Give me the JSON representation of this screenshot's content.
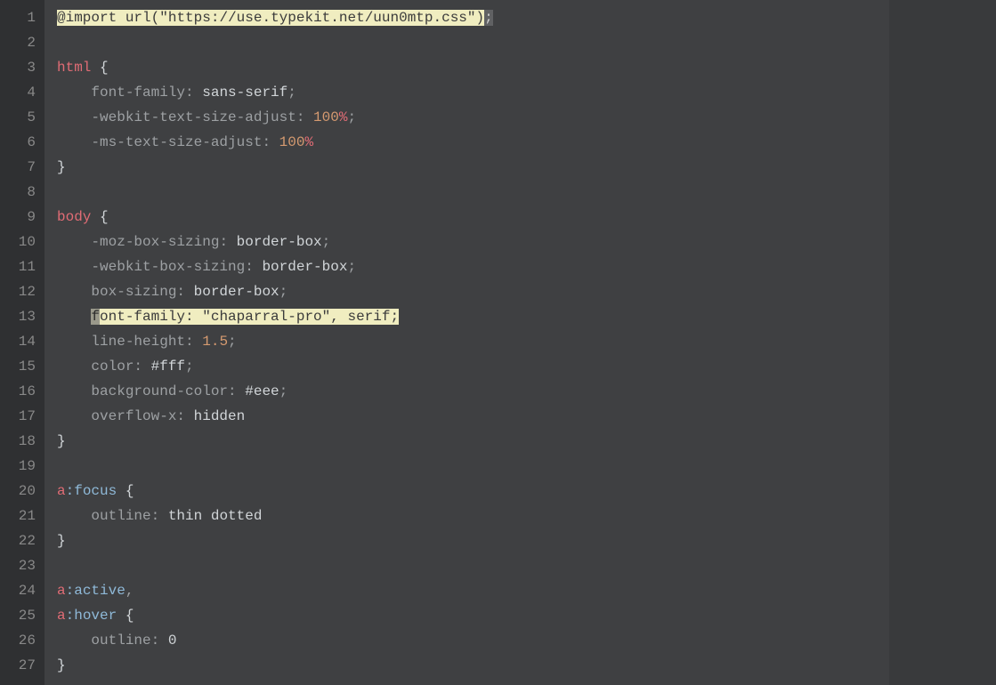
{
  "editor": {
    "lines": [
      {
        "num": "1",
        "tokens": [
          {
            "cls": "hl-yellow",
            "text": "@import"
          },
          {
            "cls": "hl-yellow",
            "text": " "
          },
          {
            "cls": "hl-yellow",
            "text": "url"
          },
          {
            "cls": "hl-yellow",
            "text": "("
          },
          {
            "cls": "hl-yellow",
            "text": "\"https://use.typekit.net/uun0mtp.css\""
          },
          {
            "cls": "hl-yellow",
            "text": ")"
          },
          {
            "cls": "hl-grey",
            "text": ";"
          }
        ]
      },
      {
        "num": "2",
        "tokens": []
      },
      {
        "num": "3",
        "tokens": [
          {
            "cls": "tok-selector",
            "text": "html"
          },
          {
            "cls": "",
            "text": " "
          },
          {
            "cls": "tok-brace",
            "text": "{"
          }
        ]
      },
      {
        "num": "4",
        "tokens": [
          {
            "cls": "",
            "text": "    "
          },
          {
            "cls": "tok-property",
            "text": "font-family"
          },
          {
            "cls": "tok-colon",
            "text": ": "
          },
          {
            "cls": "tok-value",
            "text": "sans-serif"
          },
          {
            "cls": "tok-punct",
            "text": ";"
          }
        ]
      },
      {
        "num": "5",
        "tokens": [
          {
            "cls": "",
            "text": "    "
          },
          {
            "cls": "tok-property",
            "text": "-webkit-text-size-adjust"
          },
          {
            "cls": "tok-colon",
            "text": ": "
          },
          {
            "cls": "tok-number",
            "text": "100"
          },
          {
            "cls": "tok-keyword",
            "text": "%"
          },
          {
            "cls": "tok-punct",
            "text": ";"
          }
        ]
      },
      {
        "num": "6",
        "tokens": [
          {
            "cls": "",
            "text": "    "
          },
          {
            "cls": "tok-property",
            "text": "-ms-text-size-adjust"
          },
          {
            "cls": "tok-colon",
            "text": ": "
          },
          {
            "cls": "tok-number",
            "text": "100"
          },
          {
            "cls": "tok-keyword",
            "text": "%"
          }
        ]
      },
      {
        "num": "7",
        "tokens": [
          {
            "cls": "tok-brace",
            "text": "}"
          }
        ]
      },
      {
        "num": "8",
        "tokens": []
      },
      {
        "num": "9",
        "tokens": [
          {
            "cls": "tok-selector",
            "text": "body"
          },
          {
            "cls": "",
            "text": " "
          },
          {
            "cls": "tok-brace",
            "text": "{"
          }
        ]
      },
      {
        "num": "10",
        "tokens": [
          {
            "cls": "",
            "text": "    "
          },
          {
            "cls": "tok-property",
            "text": "-moz-box-sizing"
          },
          {
            "cls": "tok-colon",
            "text": ": "
          },
          {
            "cls": "tok-value",
            "text": "border-box"
          },
          {
            "cls": "tok-punct",
            "text": ";"
          }
        ]
      },
      {
        "num": "11",
        "tokens": [
          {
            "cls": "",
            "text": "    "
          },
          {
            "cls": "tok-property",
            "text": "-webkit-box-sizing"
          },
          {
            "cls": "tok-colon",
            "text": ": "
          },
          {
            "cls": "tok-value",
            "text": "border-box"
          },
          {
            "cls": "tok-punct",
            "text": ";"
          }
        ]
      },
      {
        "num": "12",
        "tokens": [
          {
            "cls": "",
            "text": "    "
          },
          {
            "cls": "tok-property",
            "text": "box-sizing"
          },
          {
            "cls": "tok-colon",
            "text": ": "
          },
          {
            "cls": "tok-value",
            "text": "border-box"
          },
          {
            "cls": "tok-punct",
            "text": ";"
          }
        ]
      },
      {
        "num": "13",
        "tokens": [
          {
            "cls": "",
            "text": "    "
          },
          {
            "cls": "hl-dark",
            "text": "f"
          },
          {
            "cls": "hl-yellow",
            "text": "ont-family: \"chaparral-pro\", serif;"
          }
        ]
      },
      {
        "num": "14",
        "tokens": [
          {
            "cls": "",
            "text": "    "
          },
          {
            "cls": "tok-property",
            "text": "line-height"
          },
          {
            "cls": "tok-colon",
            "text": ": "
          },
          {
            "cls": "tok-number",
            "text": "1.5"
          },
          {
            "cls": "tok-punct",
            "text": ";"
          }
        ]
      },
      {
        "num": "15",
        "tokens": [
          {
            "cls": "",
            "text": "    "
          },
          {
            "cls": "tok-property",
            "text": "color"
          },
          {
            "cls": "tok-colon",
            "text": ": "
          },
          {
            "cls": "tok-hex",
            "text": "#fff"
          },
          {
            "cls": "tok-punct",
            "text": ";"
          }
        ]
      },
      {
        "num": "16",
        "tokens": [
          {
            "cls": "",
            "text": "    "
          },
          {
            "cls": "tok-property",
            "text": "background-color"
          },
          {
            "cls": "tok-colon",
            "text": ": "
          },
          {
            "cls": "tok-hex",
            "text": "#eee"
          },
          {
            "cls": "tok-punct",
            "text": ";"
          }
        ]
      },
      {
        "num": "17",
        "tokens": [
          {
            "cls": "",
            "text": "    "
          },
          {
            "cls": "tok-property",
            "text": "overflow-x"
          },
          {
            "cls": "tok-colon",
            "text": ": "
          },
          {
            "cls": "tok-value",
            "text": "hidden"
          }
        ]
      },
      {
        "num": "18",
        "tokens": [
          {
            "cls": "tok-brace",
            "text": "}"
          }
        ]
      },
      {
        "num": "19",
        "tokens": []
      },
      {
        "num": "20",
        "tokens": [
          {
            "cls": "tok-selector",
            "text": "a"
          },
          {
            "cls": "tok-pseudo",
            "text": ":focus"
          },
          {
            "cls": "",
            "text": " "
          },
          {
            "cls": "tok-brace",
            "text": "{"
          }
        ]
      },
      {
        "num": "21",
        "tokens": [
          {
            "cls": "",
            "text": "    "
          },
          {
            "cls": "tok-property",
            "text": "outline"
          },
          {
            "cls": "tok-colon",
            "text": ": "
          },
          {
            "cls": "tok-value",
            "text": "thin dotted"
          }
        ]
      },
      {
        "num": "22",
        "tokens": [
          {
            "cls": "tok-brace",
            "text": "}"
          }
        ]
      },
      {
        "num": "23",
        "tokens": []
      },
      {
        "num": "24",
        "tokens": [
          {
            "cls": "tok-selector",
            "text": "a"
          },
          {
            "cls": "tok-pseudo",
            "text": ":active"
          },
          {
            "cls": "tok-punct",
            "text": ","
          }
        ]
      },
      {
        "num": "25",
        "tokens": [
          {
            "cls": "tok-selector",
            "text": "a"
          },
          {
            "cls": "tok-pseudo",
            "text": ":hover"
          },
          {
            "cls": "",
            "text": " "
          },
          {
            "cls": "tok-brace",
            "text": "{"
          }
        ]
      },
      {
        "num": "26",
        "tokens": [
          {
            "cls": "",
            "text": "    "
          },
          {
            "cls": "tok-property",
            "text": "outline"
          },
          {
            "cls": "tok-colon",
            "text": ": "
          },
          {
            "cls": "tok-value",
            "text": "0"
          }
        ]
      },
      {
        "num": "27",
        "tokens": [
          {
            "cls": "tok-brace",
            "text": "}"
          }
        ]
      }
    ]
  }
}
